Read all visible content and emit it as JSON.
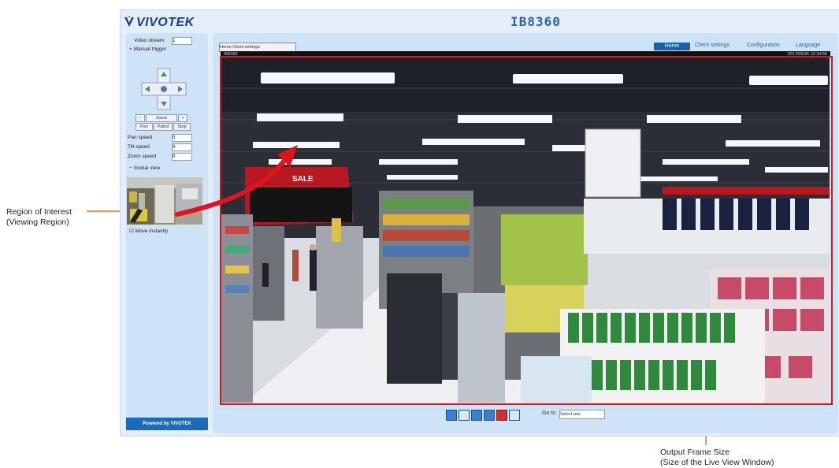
{
  "annotations": {
    "roi_line1": "Region of Interest",
    "roi_line2": "(Viewing Region)",
    "output_line1": "Output Frame Size",
    "output_line2": "(Size of the Live View Window)"
  },
  "header": {
    "logo_text": "VIVOTEK",
    "model_title": "IB8360"
  },
  "nav": {
    "home": "Home",
    "client_settings": "Client settings",
    "configuration": "Configuration",
    "language": "Language"
  },
  "left_panel": {
    "video_stream_label": "Video stream",
    "video_stream_value": "1",
    "manual_trigger_label": "Manual trigger",
    "zoom_label": "Zoom",
    "pan_label": "Pan",
    "patrol_label": "Patrol",
    "stop_label": "Stop",
    "pan_speed_label": "Pan speed",
    "tilt_speed_label": "Tilt speed",
    "zoom_speed_label": "Zoom speed",
    "global_view_label": "Global view",
    "speed_value": "0",
    "move_instantly_label": "Move instantly",
    "powered_by": "Powered by VIVOTEK"
  },
  "video": {
    "top_button": "Home  Client settings",
    "stream_left": "IB8360",
    "stream_right": "2017/05/26 12:34:56",
    "banner_text": "SALE",
    "goto_label": "Go to",
    "goto_value": "Select one"
  },
  "colors": {
    "frame_red": "#e0141c",
    "arrow_red": "#e0141c",
    "annotation_orange": "#e8742a",
    "brand_blue": "#1b5fa8"
  }
}
